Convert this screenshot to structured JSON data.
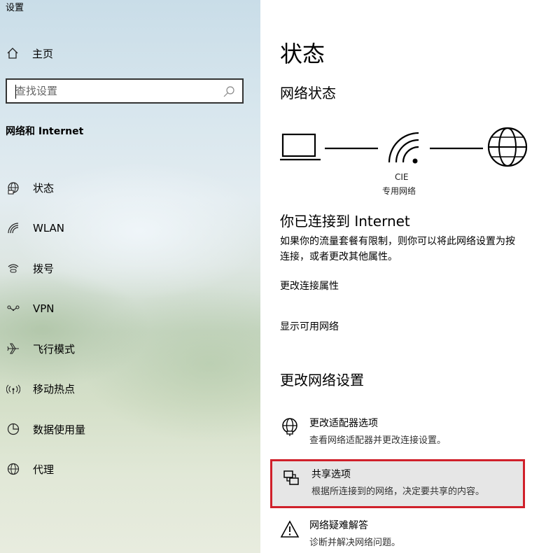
{
  "app": {
    "title": "设置"
  },
  "sidebar": {
    "home_label": "主页",
    "search_placeholder": "查找设置",
    "section_header": "网络和 Internet",
    "items": [
      {
        "label": "状态",
        "icon": "status-globe-icon"
      },
      {
        "label": "WLAN",
        "icon": "wifi-icon"
      },
      {
        "label": "拨号",
        "icon": "dialup-icon"
      },
      {
        "label": "VPN",
        "icon": "vpn-icon"
      },
      {
        "label": "飞行模式",
        "icon": "airplane-icon"
      },
      {
        "label": "移动热点",
        "icon": "hotspot-icon"
      },
      {
        "label": "数据使用量",
        "icon": "data-usage-icon"
      },
      {
        "label": "代理",
        "icon": "proxy-globe-icon"
      }
    ]
  },
  "main": {
    "title": "状态",
    "network_status_heading": "网络状态",
    "network_name": "CIE",
    "network_type": "专用网络",
    "connected_heading": "你已连接到 Internet",
    "description_line1": "如果你的流量套餐有限制，则你可以将此网络设置为按",
    "description_line2": "连接，或者更改其他属性。",
    "link_change_props": "更改连接属性",
    "link_show_networks": "显示可用网络",
    "change_settings_heading": "更改网络设置",
    "options": [
      {
        "title": "更改适配器选项",
        "desc": "查看网络适配器并更改连接设置。",
        "icon": "adapter-globe-icon"
      },
      {
        "title": "共享选项",
        "desc": "根据所连接到的网络，决定要共享的内容。",
        "icon": "sharing-icon",
        "selected": true
      },
      {
        "title": "网络疑难解答",
        "desc": "诊断并解决网络问题。",
        "icon": "warning-icon"
      }
    ]
  },
  "colors": {
    "selection_border": "#d0202a",
    "selection_bg": "#e6e6e6"
  }
}
